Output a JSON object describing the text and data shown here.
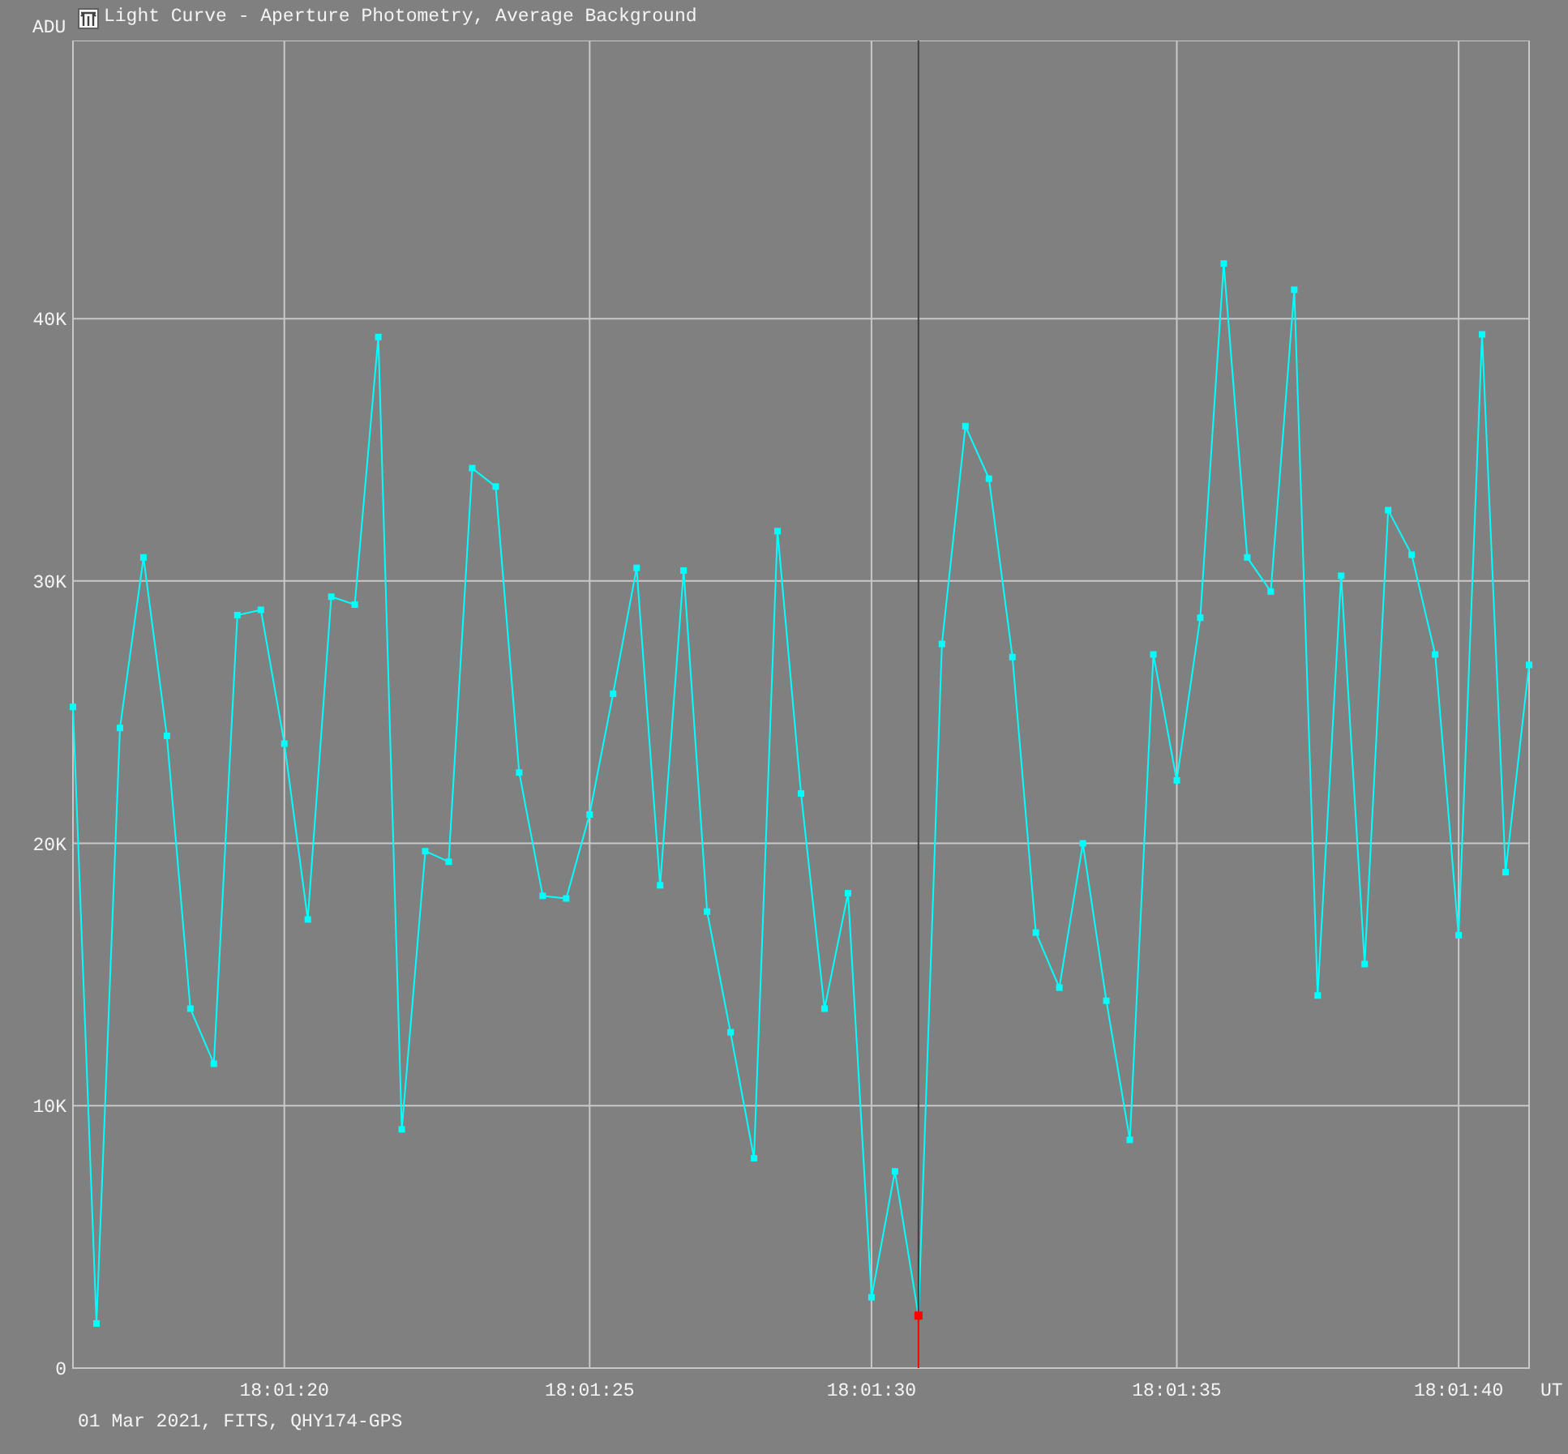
{
  "window": {
    "title": "Light Curve - Aperture Photometry, Average Background"
  },
  "chart": {
    "chart_data": {
      "type": "line",
      "xlabel": "UT",
      "ylabel": "ADU",
      "categories": [
        null,
        null,
        null,
        null,
        null,
        null,
        null,
        null,
        null,
        "18:01:20",
        null,
        null,
        null,
        null,
        null,
        null,
        null,
        null,
        null,
        null,
        null,
        null,
        "18:01:25",
        null,
        null,
        null,
        null,
        null,
        null,
        null,
        null,
        null,
        null,
        null,
        "18:01:30",
        null,
        null,
        null,
        null,
        null,
        null,
        null,
        null,
        null,
        null,
        null,
        null,
        "18:01:35",
        null,
        null,
        null,
        null,
        null,
        null,
        null,
        null,
        null,
        null,
        null,
        "18:01:40",
        null,
        null,
        null
      ],
      "grid": true,
      "series": [
        {
          "color": "#00ffff",
          "marker": "square",
          "values": [
            25200,
            1700,
            24400,
            30900,
            24100,
            13700,
            11600,
            28700,
            28900,
            23800,
            17100,
            29400,
            29100,
            39300,
            9100,
            19700,
            19300,
            34300,
            33600,
            22700,
            18000,
            17900,
            21100,
            25700,
            30500,
            18400,
            30400,
            17400,
            12800,
            8000,
            31900,
            21900,
            13700,
            18100,
            2700,
            7500,
            2000,
            27600,
            35900,
            33900,
            27100,
            16600,
            14500,
            20000,
            14000,
            8700,
            27200,
            22400,
            28600,
            42100,
            30900,
            29600,
            41100,
            14200,
            30200,
            15400,
            32700,
            31000,
            27200,
            16500,
            39400,
            18900,
            26800
          ]
        },
        {
          "color": "#ff0000",
          "marker": "square",
          "values": [
            null,
            null,
            null,
            null,
            null,
            null,
            null,
            null,
            null,
            null,
            null,
            null,
            null,
            null,
            null,
            null,
            null,
            null,
            null,
            null,
            null,
            null,
            null,
            null,
            null,
            null,
            null,
            null,
            null,
            null,
            null,
            null,
            null,
            null,
            null,
            null,
            2000,
            null,
            null,
            null,
            null,
            null,
            null,
            null,
            null,
            null,
            null,
            null,
            null,
            null,
            null,
            null,
            null,
            null,
            null,
            null,
            null,
            null,
            null,
            null,
            null,
            null,
            null
          ]
        }
      ],
      "ylim": [
        0,
        50600
      ],
      "yticks": [
        {
          "value": 0,
          "label": "0"
        },
        {
          "value": 10000,
          "label": "10K"
        },
        {
          "value": 20000,
          "label": "20K"
        },
        {
          "value": 30000,
          "label": "30K"
        },
        {
          "value": 40000,
          "label": "40K"
        }
      ]
    }
  },
  "footer": "01 Mar 2021, FITS, QHY174-GPS"
}
